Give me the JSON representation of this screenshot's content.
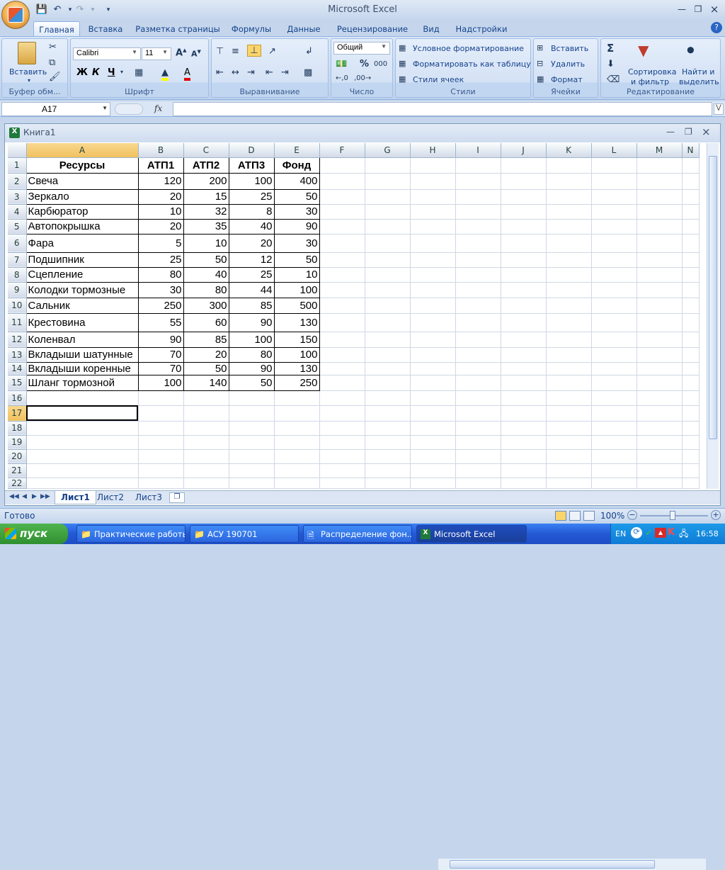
{
  "app": {
    "title": "Microsoft Excel"
  },
  "ribbon_tabs": [
    "Главная",
    "Вставка",
    "Разметка страницы",
    "Формулы",
    "Данные",
    "Рецензирование",
    "Вид",
    "Надстройки"
  ],
  "clipboard": {
    "paste": "Вставить",
    "label": "Буфер обм..."
  },
  "font": {
    "name": "Calibri",
    "size": "11",
    "bold": "Ж",
    "italic": "К",
    "underline": "Ч",
    "label": "Шрифт"
  },
  "alignment": {
    "label": "Выравнивание"
  },
  "number": {
    "format": "Общий",
    "percent": "%",
    "thousands": "000",
    "label": "Число"
  },
  "styles": {
    "conditional": "Условное форматирование",
    "as_table": "Форматировать как таблицу",
    "cell_styles": "Стили ячеек",
    "label": "Стили"
  },
  "cells": {
    "insert": "Вставить",
    "delete": "Удалить",
    "format": "Формат",
    "label": "Ячейки"
  },
  "editing": {
    "sum": "Σ",
    "sort_filter_1": "Сортировка",
    "sort_filter_2": "и фильтр",
    "find_1": "Найти и",
    "find_2": "выделить",
    "label": "Редактирование"
  },
  "formula_bar": {
    "name_box": "A17",
    "fx": "fx",
    "formula": ""
  },
  "workbook": {
    "title": "Книга1"
  },
  "columns": [
    "A",
    "B",
    "C",
    "D",
    "E",
    "F",
    "G",
    "H",
    "I",
    "J",
    "K",
    "L",
    "M",
    "N"
  ],
  "table": {
    "headers": [
      "Ресурсы",
      "АТП1",
      "АТП2",
      "АТП3",
      "Фонд"
    ],
    "rows": [
      [
        "Свеча",
        "120",
        "200",
        "100",
        "400"
      ],
      [
        "Зеркало",
        "20",
        "15",
        "25",
        "50"
      ],
      [
        "Карбюратор",
        "10",
        "32",
        "8",
        "30"
      ],
      [
        "Автопокрышка",
        "20",
        "35",
        "40",
        "90"
      ],
      [
        "Фара",
        "5",
        "10",
        "20",
        "30"
      ],
      [
        "Подшипник",
        "25",
        "50",
        "12",
        "50"
      ],
      [
        "Сцепление",
        "80",
        "40",
        "25",
        "10"
      ],
      [
        "Колодки тормозные",
        "30",
        "80",
        "44",
        "100"
      ],
      [
        "Сальник",
        "250",
        "300",
        "85",
        "500"
      ],
      [
        "Крестовина",
        "55",
        "60",
        "90",
        "130"
      ],
      [
        "Коленвал",
        "90",
        "85",
        "100",
        "150"
      ],
      [
        "Вкладыши шатунные",
        "70",
        "20",
        "80",
        "100"
      ],
      [
        "Вкладыши коренные",
        "70",
        "50",
        "90",
        "130"
      ],
      [
        "Шланг тормозной",
        "100",
        "140",
        "50",
        "250"
      ]
    ]
  },
  "row_numbers": [
    "1",
    "2",
    "3",
    "4",
    "5",
    "6",
    "7",
    "8",
    "9",
    "10",
    "11",
    "12",
    "13",
    "14",
    "15",
    "16",
    "17",
    "18",
    "19",
    "20",
    "21",
    "22"
  ],
  "sheets": [
    "Лист1",
    "Лист2",
    "Лист3"
  ],
  "status": {
    "ready": "Готово",
    "zoom": "100%"
  },
  "taskbar": {
    "start": "пуск",
    "items": [
      "Практические работы",
      "АСУ 190701",
      "Распределение фон...",
      "Microsoft Excel"
    ],
    "lang": "EN",
    "clock": "16:58"
  }
}
